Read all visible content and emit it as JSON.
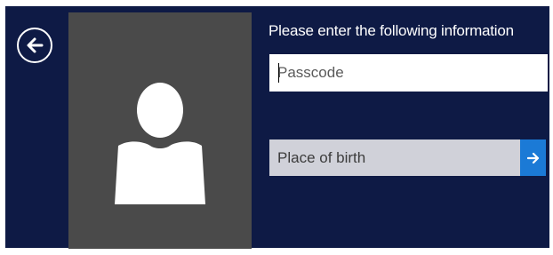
{
  "prompt": {
    "text": "Please enter the following information"
  },
  "fields": {
    "passcode": {
      "placeholder": "Passcode",
      "value": ""
    },
    "place_of_birth": {
      "label": "Place of birth"
    }
  },
  "icons": {
    "back": "back-arrow-icon",
    "user": "user-silhouette-icon",
    "submit": "right-arrow-icon"
  },
  "colors": {
    "background": "#0e1a45",
    "tile": "#4a4a4a",
    "accent": "#1b7ad6",
    "field_inactive": "#d0d1d9"
  }
}
